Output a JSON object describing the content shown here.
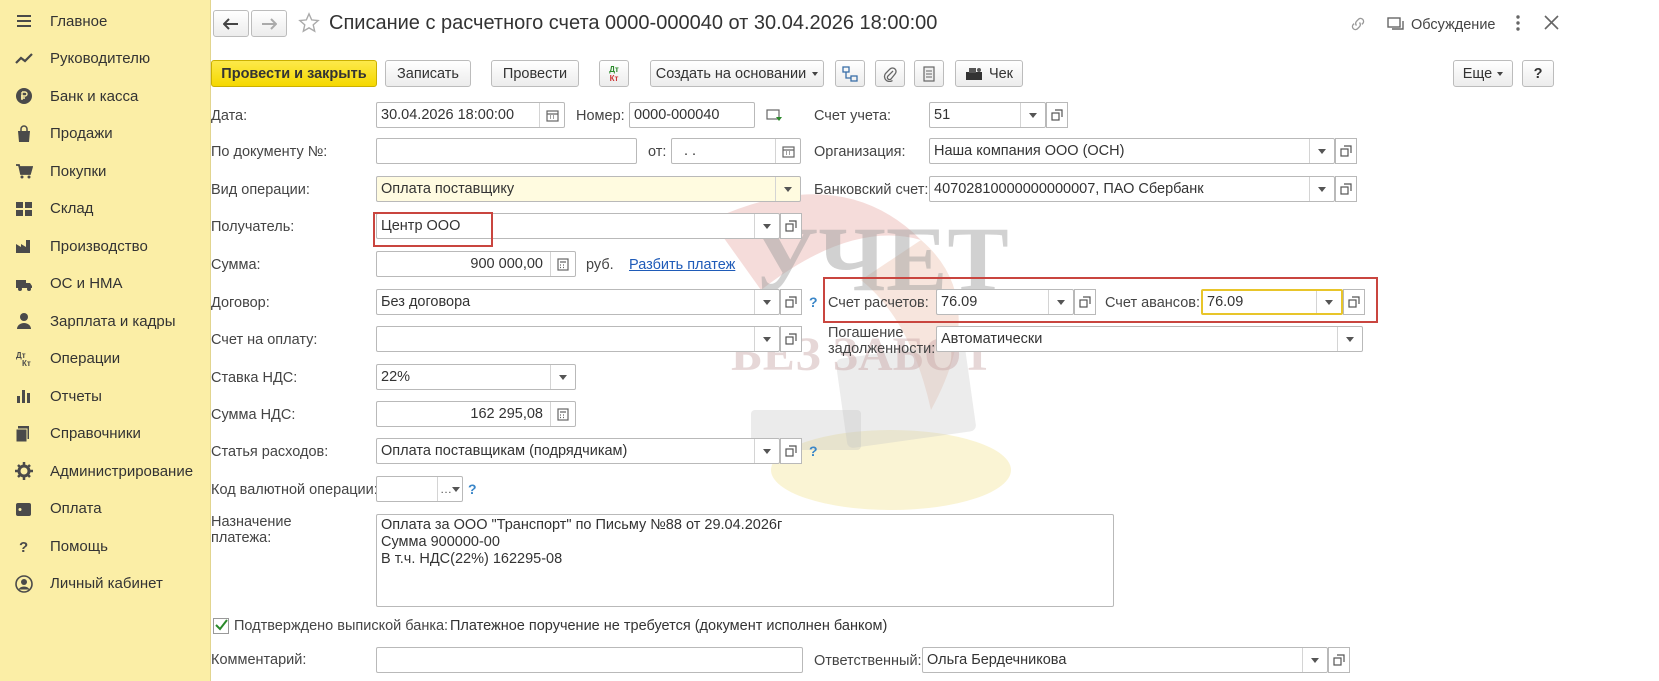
{
  "sidebar": {
    "items": [
      {
        "label": "Главное",
        "icon": "menu-icon"
      },
      {
        "label": "Руководителю",
        "icon": "trend-icon"
      },
      {
        "label": "Банк и касса",
        "icon": "ruble-icon"
      },
      {
        "label": "Продажи",
        "icon": "bag-icon"
      },
      {
        "label": "Покупки",
        "icon": "cart-icon"
      },
      {
        "label": "Склад",
        "icon": "warehouse-icon"
      },
      {
        "label": "Производство",
        "icon": "factory-icon"
      },
      {
        "label": "ОС и НМА",
        "icon": "truck-icon"
      },
      {
        "label": "Зарплата и кадры",
        "icon": "person-icon"
      },
      {
        "label": "Операции",
        "icon": "dtkt-icon"
      },
      {
        "label": "Отчеты",
        "icon": "bar-chart-icon"
      },
      {
        "label": "Справочники",
        "icon": "books-icon"
      },
      {
        "label": "Администрирование",
        "icon": "gear-icon"
      },
      {
        "label": "Оплата",
        "icon": "wallet-icon"
      },
      {
        "label": "Помощь",
        "icon": "question-icon"
      },
      {
        "label": "Личный кабинет",
        "icon": "user-circle-icon"
      }
    ]
  },
  "header": {
    "title": "Списание с расчетного счета 0000-000040 от 30.04.2026 18:00:00",
    "discussion": "Обсуждение"
  },
  "toolbar": {
    "post_close": "Провести и закрыть",
    "save": "Записать",
    "post": "Провести",
    "dtkt_top": "Дт",
    "dtkt_bottom": "Кт",
    "create_based": "Создать на основании",
    "receipt": "Чек",
    "more": "Еще",
    "help": "?"
  },
  "form": {
    "date_label": "Дата:",
    "date_value": "30.04.2026 18:00:00",
    "number_label": "Номер:",
    "number_value": "0000-000040",
    "account_label": "Счет учета:",
    "account_value": "51",
    "doc_no_label": "По документу №:",
    "doc_no_value": "",
    "from_label": "от:",
    "from_value": ".  .",
    "org_label": "Организация:",
    "org_value": "Наша компания ООО (ОСН)",
    "op_label": "Вид операции:",
    "op_value": "Оплата поставщику",
    "bank_label": "Банковский счет:",
    "bank_value": "40702810000000000007, ПАО Сбербанк",
    "recipient_label": "Получатель:",
    "recipient_value": "Центр ООО",
    "sum_label": "Сумма:",
    "sum_value": "900 000,00",
    "currency": "руб.",
    "split_link": "Разбить платеж",
    "contract_label": "Договор:",
    "contract_value": "Без договора",
    "settle_label": "Счет расчетов:",
    "settle_value": "76.09",
    "advance_label": "Счет авансов:",
    "advance_value": "76.09",
    "invoice_label": "Счет на оплату:",
    "invoice_value": "",
    "repay_label_1": "Погашение",
    "repay_label_2": "задолженности:",
    "repay_value": "Автоматически",
    "vat_rate_label": "Ставка НДС:",
    "vat_rate_value": "22%",
    "vat_sum_label": "Сумма НДС:",
    "vat_sum_value": "162 295,08",
    "expense_label": "Статья расходов:",
    "expense_value": "Оплата поставщикам (подрядчикам)",
    "currency_op_label": "Код валютной операции:",
    "currency_op_value": "",
    "purpose_label_1": "Назначение",
    "purpose_label_2": "платежа:",
    "purpose_line_1": "Оплата за ООО \"Транспорт\" по Письму №88 от 29.04.2026г",
    "purpose_line_2": "Сумма 900000-00",
    "purpose_line_3": "В т.ч. НДС(22%) 162295-08",
    "confirmed_label": "Подтверждено выпиской банка:",
    "confirmed_checked": true,
    "payment_order_note": "Платежное поручение не требуется (документ исполнен банком)",
    "comment_label": "Комментарий:",
    "comment_value": "",
    "responsible_label": "Ответственный:",
    "responsible_value": "Ольга Бердечникова"
  },
  "watermark": {
    "line1": "УЧЕТ",
    "line2": "БЕЗ ЗАБОТ"
  },
  "colors": {
    "sidebar_bg": "#fbeea6",
    "primary_button": "#f5d800",
    "highlight_box": "#c9453f",
    "active_field": "#e8c52a",
    "link": "#1f5bb8"
  }
}
